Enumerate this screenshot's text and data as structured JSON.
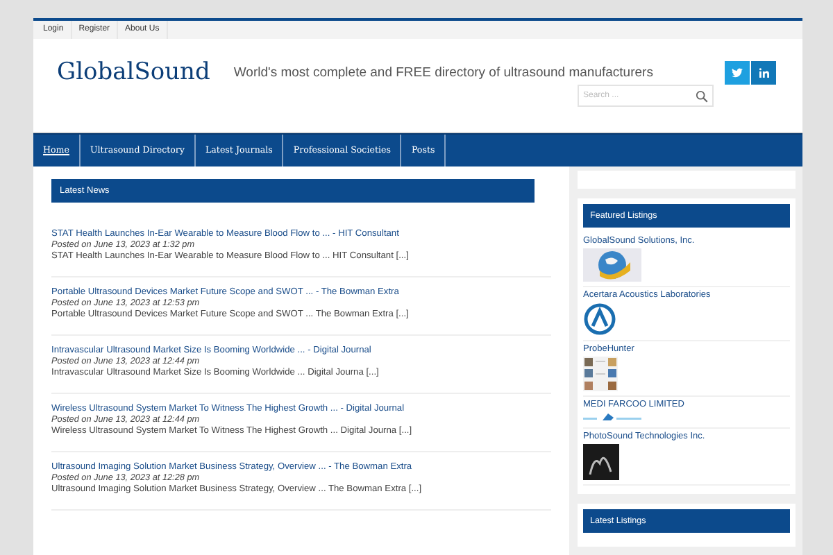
{
  "top_links": [
    {
      "label": "Login"
    },
    {
      "label": "Register"
    },
    {
      "label": "About Us"
    }
  ],
  "header": {
    "site_title": "GlobalSound",
    "tagline": "World's most complete and FREE directory of ultrasound manufacturers",
    "search": {
      "placeholder": "Search ..."
    },
    "social": [
      {
        "kind": "twitter"
      },
      {
        "kind": "linkedin"
      }
    ]
  },
  "nav": [
    {
      "label": "Home",
      "selected": true
    },
    {
      "label": "Ultrasound Directory",
      "selected": false
    },
    {
      "label": "Latest Journals",
      "selected": false
    },
    {
      "label": "Professional Societies",
      "selected": false
    },
    {
      "label": "Posts",
      "selected": false
    }
  ],
  "news": {
    "title": "Latest News",
    "items": [
      {
        "title": "STAT Health Launches In-Ear Wearable to Measure Blood Flow to ... - HIT Consultant",
        "posted": "Posted on June 13, 2023 at 1:32 pm",
        "excerpt": "STAT Health Launches In-Ear Wearable to Measure Blood Flow to ...  HIT Consultant [...]"
      },
      {
        "title": "Portable Ultrasound Devices Market Future Scope and SWOT ... - The Bowman Extra",
        "posted": "Posted on June 13, 2023 at 12:53 pm",
        "excerpt": "Portable Ultrasound Devices Market Future Scope and SWOT ...  The Bowman Extra [...]"
      },
      {
        "title": "Intravascular Ultrasound Market Size Is Booming Worldwide ... - Digital Journal",
        "posted": "Posted on June 13, 2023 at 12:44 pm",
        "excerpt": "Intravascular Ultrasound Market Size Is Booming Worldwide ...  Digital Journa [...]"
      },
      {
        "title": "Wireless Ultrasound System Market To Witness The Highest Growth ... - Digital Journal",
        "posted": "Posted on June 13, 2023 at 12:44 pm",
        "excerpt": "Wireless Ultrasound System Market To Witness The Highest Growth ...  Digital Journa [...]"
      },
      {
        "title": "Ultrasound Imaging Solution Market Business Strategy, Overview ... - The Bowman Extra",
        "posted": "Posted on June 13, 2023 at 12:28 pm",
        "excerpt": "Ultrasound Imaging Solution Market Business Strategy, Overview ...  The Bowman Extra [...]"
      }
    ]
  },
  "featured": {
    "title": "Featured Listings",
    "items": [
      {
        "name": "GlobalSound Solutions, Inc.",
        "kind": "globe"
      },
      {
        "name": "Acertara Acoustics Laboratories",
        "kind": "ring"
      },
      {
        "name": "ProbeHunter",
        "kind": "grid"
      },
      {
        "name": "MEDI FARCOO LIMITED",
        "kind": "bird"
      },
      {
        "name": "PhotoSound Technologies Inc.",
        "kind": "photo"
      }
    ]
  },
  "latest_listings": {
    "title": "Latest Listings"
  }
}
